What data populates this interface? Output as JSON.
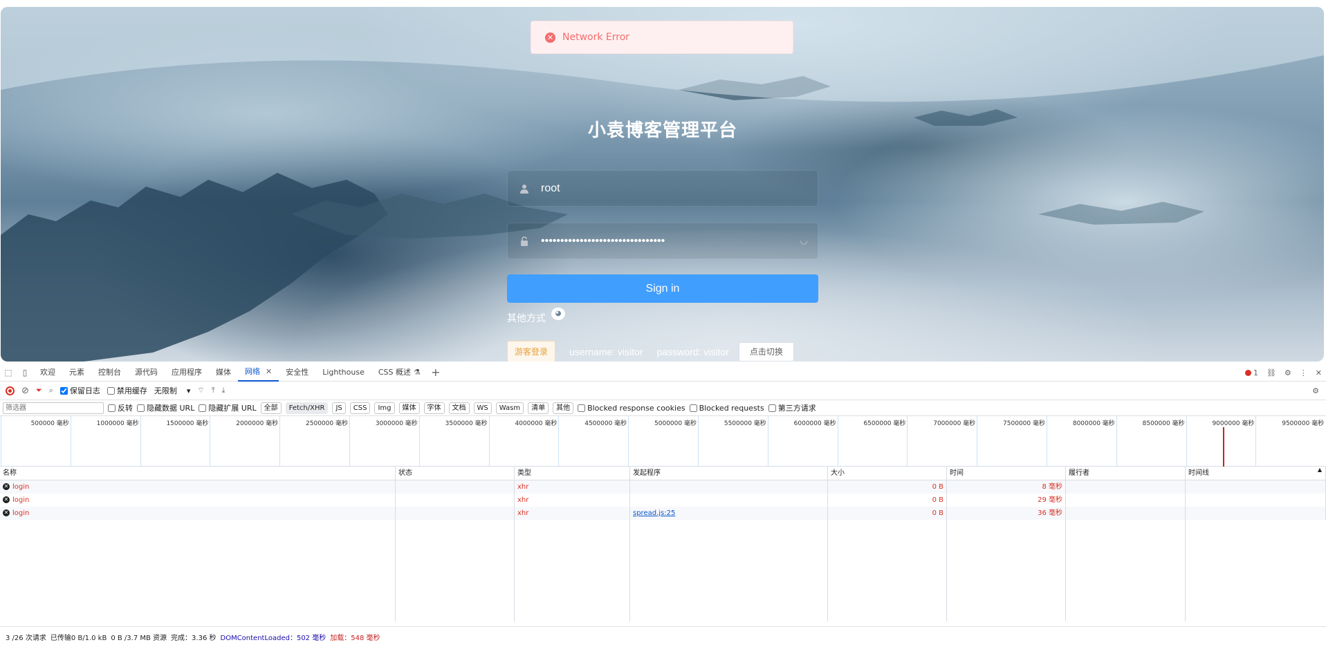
{
  "login": {
    "toast": "Network Error",
    "title": "小袁博客管理平台",
    "username_value": "root",
    "password_value": "••••••••••••••••••••••••••••••••",
    "signin_label": "Sign in",
    "other_methods": "其他方式",
    "guest_button": "游客登录",
    "username_hint": "username: visitor",
    "password_hint": "password: visitor",
    "switch_button": "点击切换"
  },
  "devtools": {
    "tabs": [
      "欢迎",
      "元素",
      "控制台",
      "源代码",
      "应用程序",
      "媒体",
      "网络",
      "安全性",
      "Lighthouse",
      "CSS 概述"
    ],
    "active_tab": "网络",
    "error_count": "1",
    "toolbar": {
      "preserve_log": "保留日志",
      "disable_cache": "禁用缓存",
      "throttle": "无限制"
    },
    "filter": {
      "placeholder": "筛选器",
      "invert": "反转",
      "hide_data_url": "隐藏数据 URL",
      "hide_ext_url": "隐藏扩展 URL",
      "types": [
        "全部",
        "Fetch/XHR",
        "JS",
        "CSS",
        "Img",
        "媒体",
        "字体",
        "文档",
        "WS",
        "Wasm",
        "清单",
        "其他"
      ],
      "active_type": "Fetch/XHR",
      "blocked_cookies": "Blocked response cookies",
      "blocked_requests": "Blocked requests",
      "third_party": "第三方请求"
    },
    "overview_ticks": [
      "500000 毫秒",
      "1000000 毫秒",
      "1500000 毫秒",
      "2000000 毫秒",
      "2500000 毫秒",
      "3000000 毫秒",
      "3500000 毫秒",
      "4000000 毫秒",
      "4500000 毫秒",
      "5000000 毫秒",
      "5500000 毫秒",
      "6000000 毫秒",
      "6500000 毫秒",
      "7000000 毫秒",
      "7500000 毫秒",
      "8000000 毫秒",
      "8500000 毫秒",
      "9000000 毫秒",
      "9500000 毫秒"
    ],
    "columns": [
      "名称",
      "状态",
      "类型",
      "发起程序",
      "大小",
      "时间",
      "履行者",
      "时间线"
    ],
    "rows": [
      {
        "name": "login",
        "status": "",
        "type": "xhr",
        "initiator": "",
        "size": "0 B",
        "time": "8 毫秒"
      },
      {
        "name": "login",
        "status": "",
        "type": "xhr",
        "initiator": "",
        "size": "0 B",
        "time": "29 毫秒"
      },
      {
        "name": "login",
        "status": "",
        "type": "xhr",
        "initiator": "spread.js:25",
        "size": "0 B",
        "time": "36 毫秒"
      }
    ],
    "status_bar": {
      "requests": "3 /26 次请求",
      "transferred": "已传输0 B/1.0 kB",
      "resources": "0 B /3.7 MB 资源",
      "finish": "完成：3.36 秒",
      "dcl": "DOMContentLoaded：502 毫秒",
      "load": "加载：548 毫秒"
    }
  }
}
